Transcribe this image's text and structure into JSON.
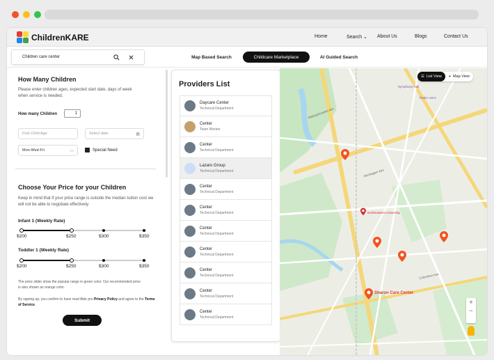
{
  "brand": {
    "name": "ChildrenKARE",
    "colors": {
      "red": "#e53935",
      "green": "#43a047",
      "blue": "#1e88e5",
      "yellow": "#fdd835"
    }
  },
  "nav": {
    "home": "Home",
    "search": "Search",
    "about": "About Us",
    "blogs": "Blogs",
    "contact": "Contact Us"
  },
  "search": {
    "value": "Children care center"
  },
  "tabs": {
    "map": "Map Based Search",
    "marketplace": "Childcare Marketplace",
    "ai": "AI Guided Search"
  },
  "how_many": {
    "title": "How Many Children",
    "desc": "Please enter children ages, expected start date, days of week when service is needed.",
    "count_label": "How many Children",
    "count_value": "1",
    "age_placeholder": "First Child Age",
    "date_placeholder": "Select date",
    "days_value": "Mon-Wed-Fri",
    "special_need": "Special Need"
  },
  "price": {
    "title": "Choose Your Price for your Children",
    "desc": "Keep in mind that if your price range is outside the median tuition cost we will not be able to negotiate effectively.",
    "infant_label": "Infant 1 (Weekly Rate)",
    "toddler_label": "Toddler 1 (Weekly Rate)",
    "ticks": [
      "$200",
      "$250",
      "$300",
      "$350"
    ],
    "infant_range": [
      200,
      250
    ],
    "toddler_range": [
      200,
      250
    ],
    "note": "The price slider show the popular range in green color. Our recommended price is also shown as orange color.",
    "terms_pre": "By signing up, you confirm to have read Able pro ",
    "privacy": "Privacy Policy",
    "terms_mid": " and agree to the ",
    "terms": "Terms of Service",
    "submit": "Submit"
  },
  "providers": {
    "title": "Providers List",
    "items": [
      {
        "name": "Daycare Center",
        "role": "Technical Department"
      },
      {
        "name": "Center",
        "role": "Team Worker"
      },
      {
        "name": "Center",
        "role": "Technical Department"
      },
      {
        "name": "Lazaro Group",
        "role": "Technical Department"
      },
      {
        "name": "Center",
        "role": "Technical Department"
      },
      {
        "name": "Center",
        "role": "Technical Department"
      },
      {
        "name": "Center",
        "role": "Technical Department"
      },
      {
        "name": "Center",
        "role": "Technical Department"
      },
      {
        "name": "Center",
        "role": "Technical Department"
      },
      {
        "name": "Center",
        "role": "Technical Department"
      },
      {
        "name": "Center",
        "role": "Technical Department"
      }
    ]
  },
  "map": {
    "list_view": "List View",
    "map_view": "Map View",
    "labels": {
      "northeastern": "Northeastern University",
      "sharon": "Sharon Care Center",
      "huntington": "Huntington Ave",
      "mass_ave": "Massachusetts Ave",
      "columbus": "Columbus Ave",
      "trader": "Trader Joe's",
      "symphony": "Symphony Hall"
    }
  }
}
